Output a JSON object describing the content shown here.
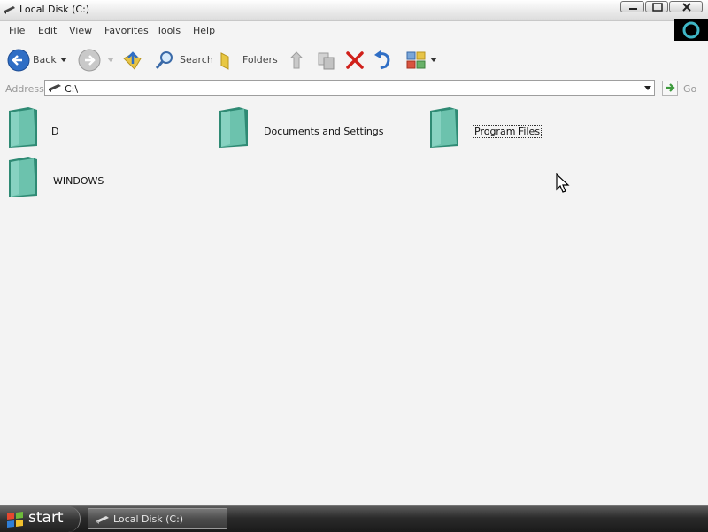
{
  "window": {
    "title": "Local Disk (C:)"
  },
  "menu": [
    "File",
    "Edit",
    "View",
    "Favorites",
    "Tools",
    "Help"
  ],
  "toolbar": {
    "back_label": "Back",
    "search_label": "Search",
    "folders_label": "Folders"
  },
  "address": {
    "label": "Address",
    "value": "C:\\",
    "go_label": "Go"
  },
  "folders": [
    {
      "name": "D",
      "selected": false
    },
    {
      "name": "Documents and Settings",
      "selected": false
    },
    {
      "name": "Program Files",
      "selected": true
    },
    {
      "name": "WINDOWS",
      "selected": false
    }
  ],
  "taskbar": {
    "start_label": "start",
    "task_item": "Local Disk (C:)"
  },
  "colors": {
    "folder": "#5fb3a0",
    "accent_blue": "#2f6ec5",
    "go_green": "#3c9a3c",
    "delete_red": "#d0201a"
  }
}
